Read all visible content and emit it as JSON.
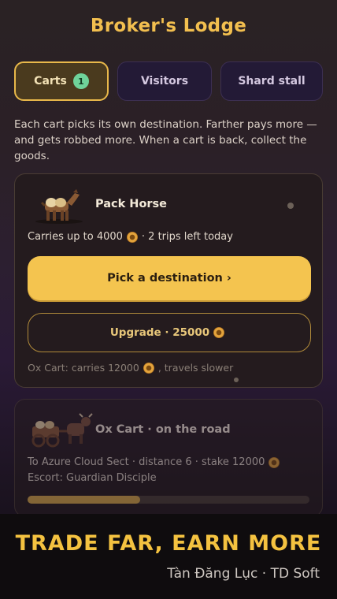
{
  "header": {
    "title": "Broker's Lodge"
  },
  "tabs": [
    {
      "label": "Carts",
      "badge": "1",
      "active": true
    },
    {
      "label": "Visitors"
    },
    {
      "label": "Shard stall"
    }
  ],
  "intro": "Each cart picks its own destination. Farther pays more — and gets robbed more. When a cart is back, collect the goods.",
  "card1": {
    "title": "Pack Horse",
    "capacity_prefix": "Carries up to 4000",
    "capacity_suffix": "· 2 trips left today",
    "primary_button": "Pick a destination ›",
    "upgrade_button": "Upgrade · 25000",
    "upgrade_note_prefix": "Ox Cart: carries 12000",
    "upgrade_note_suffix": ", travels slower"
  },
  "card2": {
    "title": "Ox Cart · on the road",
    "route_prefix": "To Azure Cloud Sect · distance 6 · stake 12000",
    "escort": "Escort: Guardian Disciple",
    "progress": 0.4
  },
  "footer": {
    "tagline": "TRADE FAR, EARN MORE",
    "credit": "Tàn Đăng Lục · TD Soft"
  },
  "colors": {
    "accent": "#f4c44f",
    "badge": "#6fd39a",
    "tab_active_border": "#e8b84a"
  }
}
